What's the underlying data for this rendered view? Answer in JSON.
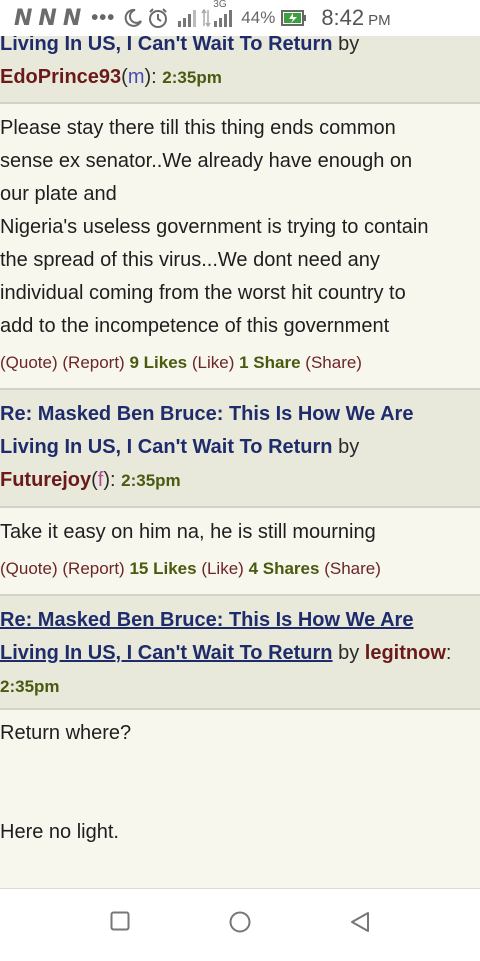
{
  "status_bar": {
    "notifications": [
      "N",
      "N",
      "N"
    ],
    "more": "•••",
    "network": "3G",
    "battery": "44%",
    "time": "8:42",
    "ampm": "PM"
  },
  "posts": [
    {
      "title_lines": [
        "Living In US, I Can't Wait To Return"
      ],
      "by": "by",
      "user": "EdoPrince93",
      "gender": "m",
      "time": "2:35pm",
      "body": [
        "Please stay there till this thing ends common",
        "sense ex senator..We already have enough on",
        "our plate and",
        "Nigeria's useless government is trying to contain",
        "the spread of this virus...We dont need any",
        "individual coming from the worst hit country to",
        "add to the incompetence of this government"
      ],
      "actions": {
        "quote": "(Quote)",
        "report": "(Report)",
        "likes": "9 Likes",
        "like": "(Like)",
        "shares": "1 Share",
        "share": "(Share)"
      }
    },
    {
      "title_lines": [
        "Re: Masked Ben Bruce: This Is How We Are",
        "Living In US, I Can't Wait To Return"
      ],
      "by": "by",
      "user": "Futurejoy",
      "gender": "f",
      "time": "2:35pm",
      "body": [
        "Take it easy on him na, he is still mourning"
      ],
      "actions": {
        "quote": "(Quote)",
        "report": "(Report)",
        "likes": "15 Likes",
        "like": "(Like)",
        "shares": "4 Shares",
        "share": "(Share)"
      }
    },
    {
      "title_lines": [
        "Re: Masked Ben Bruce: This Is How We Are",
        "Living In US, I Can't Wait To Return"
      ],
      "by": "by",
      "user": "legitnow",
      "time": "2:35pm",
      "body": [
        "Return where?",
        "Here no light."
      ]
    }
  ],
  "nav": {
    "recents_icon": "square-icon",
    "home_icon": "circle-icon",
    "back_icon": "triangle-back-icon"
  }
}
